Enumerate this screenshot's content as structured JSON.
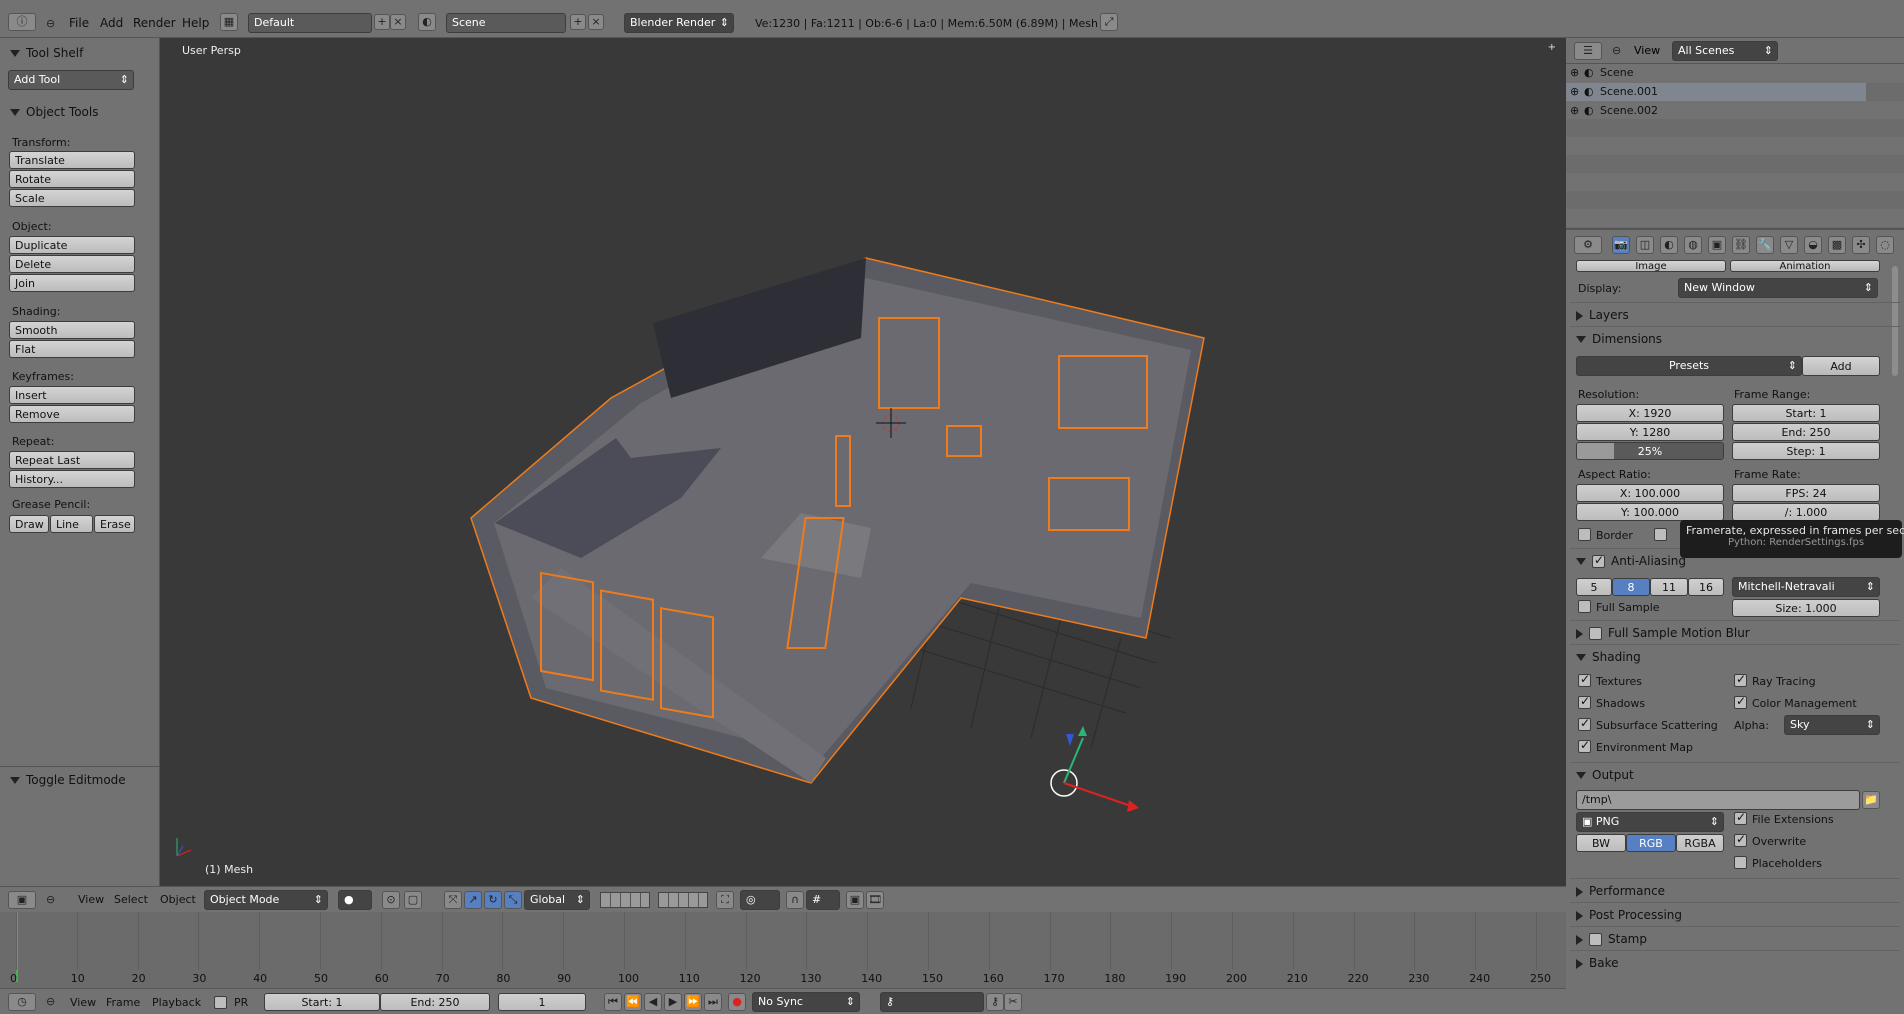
{
  "topbar": {
    "menus": [
      "File",
      "Add",
      "Render",
      "Help"
    ],
    "layout": "Default",
    "scene": "Scene",
    "engine": "Blender Render",
    "stats": "Ve:1230 | Fa:1211 | Ob:6-6 | La:0 | Mem:6.50M (6.89M) | Mesh"
  },
  "toolshelf": {
    "title": "Tool Shelf",
    "add_tool": "Add Tool",
    "object_tools": "Object Tools",
    "groups": [
      {
        "label": "Transform:",
        "buttons": [
          "Translate",
          "Rotate",
          "Scale"
        ]
      },
      {
        "label": "Object:",
        "buttons": [
          "Duplicate",
          "Delete",
          "Join"
        ]
      },
      {
        "label": "Shading:",
        "buttons": [
          "Smooth",
          "Flat"
        ]
      },
      {
        "label": "Keyframes:",
        "buttons": [
          "Insert",
          "Remove"
        ]
      },
      {
        "label": "Repeat:",
        "buttons": [
          "Repeat Last",
          "History..."
        ]
      },
      {
        "label": "Grease Pencil:",
        "buttons": [
          "Draw",
          "Line",
          "Erase"
        ]
      }
    ],
    "toggle_editmode": "Toggle Editmode"
  },
  "viewport": {
    "view_label": "User Persp",
    "object_label": "(1) Mesh",
    "header": {
      "menus": [
        "View",
        "Select",
        "Object"
      ],
      "mode": "Object Mode",
      "orientation": "Global"
    }
  },
  "timeline": {
    "ticks": [
      "0",
      "10",
      "20",
      "30",
      "40",
      "50",
      "60",
      "70",
      "80",
      "90",
      "100",
      "110",
      "120",
      "130",
      "140",
      "150",
      "160",
      "170",
      "180",
      "190",
      "200",
      "210",
      "220",
      "230",
      "240",
      "250"
    ],
    "menus": [
      "View",
      "Frame",
      "Playback"
    ],
    "pr_label": "PR",
    "start": "Start: 1",
    "end": "End: 250",
    "current": "1",
    "sync": "No Sync"
  },
  "outliner": {
    "view": "View",
    "filter": "All Scenes",
    "items": [
      "Scene",
      "Scene.001",
      "Scene.002"
    ]
  },
  "properties": {
    "render_buttons": [
      "Image",
      "Animation"
    ],
    "display_label": "Display:",
    "display_value": "New Window",
    "layers": "Layers",
    "dimensions": "Dimensions",
    "presets": "Presets",
    "add": "Add",
    "resolution_label": "Resolution:",
    "res_x": "X: 1920",
    "res_y": "Y: 1280",
    "res_pct": "25%",
    "res_pct_value": 0.25,
    "frame_range_label": "Frame Range:",
    "start": "Start: 1",
    "end": "End: 250",
    "step": "Step: 1",
    "aspect_label": "Aspect Ratio:",
    "aspect_x": "X: 100.000",
    "aspect_y": "Y: 100.000",
    "frame_rate_label": "Frame Rate:",
    "fps": "FPS: 24",
    "fps_base": "/: 1.000",
    "border": "Border",
    "tooltip_title": "Framerate, expressed in frames per second",
    "tooltip_python": "Python: RenderSettings.fps",
    "anti_aliasing": "Anti-Aliasing",
    "aa_samples": [
      "5",
      "8",
      "11",
      "16"
    ],
    "aa_filter": "Mitchell-Netravali",
    "full_sample": "Full Sample",
    "aa_size": "Size: 1.000",
    "full_sample_motion_blur": "Full Sample Motion Blur",
    "shading": "Shading",
    "shading_left": [
      "Textures",
      "Shadows",
      "Subsurface Scattering",
      "Environment Map"
    ],
    "shading_right": [
      "Ray Tracing",
      "Color Management"
    ],
    "alpha_label": "Alpha:",
    "alpha_value": "Sky",
    "output": "Output",
    "output_path": "/tmp\\",
    "format": "PNG",
    "color_modes": [
      "BW",
      "RGB",
      "RGBA"
    ],
    "output_checks": [
      "File Extensions",
      "Overwrite",
      "Placeholders"
    ],
    "collapsed": [
      "Performance",
      "Post Processing",
      "Stamp",
      "Bake"
    ]
  },
  "colors": {
    "accent": "#5680c2",
    "selection": "#f07b1a",
    "background": "#393939",
    "panel": "#727272"
  }
}
